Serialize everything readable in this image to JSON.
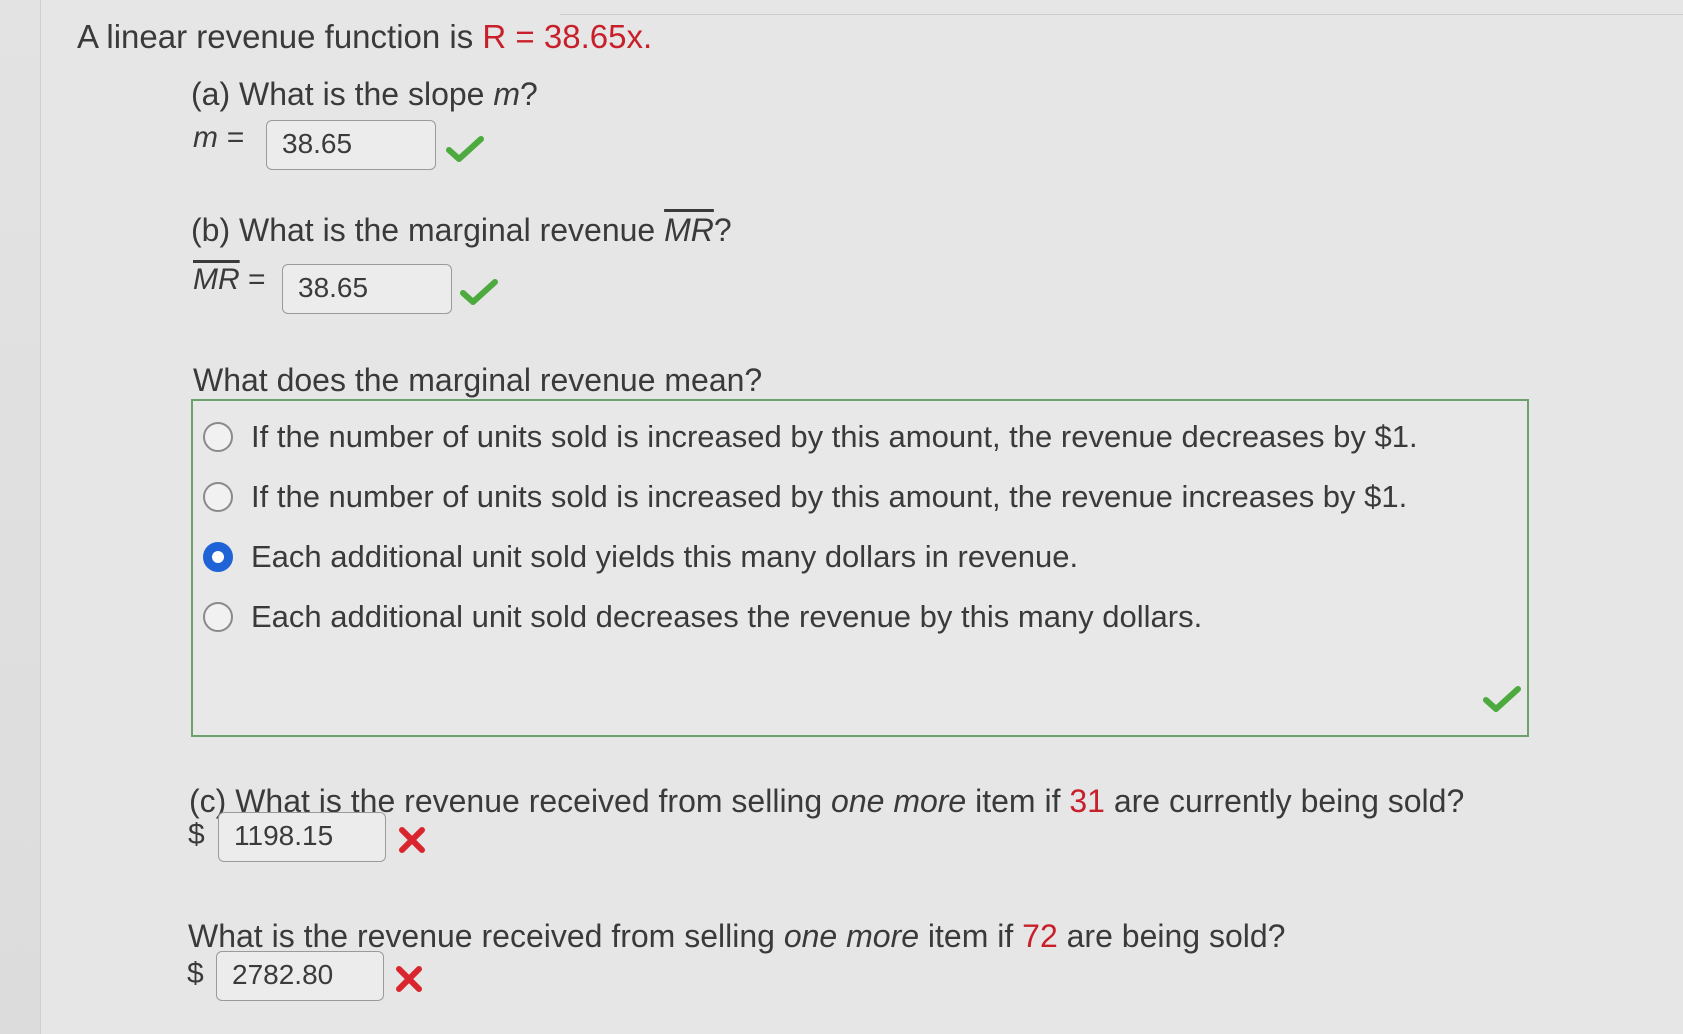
{
  "problem": {
    "intro": "A linear revenue function is",
    "equation": "R = 38.65x."
  },
  "part_a": {
    "label": "(a)",
    "question_prefix": "What is the slope",
    "question_var": "m",
    "question_suffix": "?",
    "eq_label": "m =",
    "answer": "38.65",
    "status": "correct"
  },
  "part_b": {
    "label": "(b)",
    "question_prefix": "What is the marginal revenue",
    "question_var": "MR",
    "question_suffix": "?",
    "eq_var": "MR",
    "eq_sign": "=",
    "answer": "38.65",
    "status": "correct"
  },
  "meaning": {
    "question": "What does the marginal revenue mean?",
    "options": [
      {
        "text": "If the number of units sold is increased by this amount, the revenue decreases by $1.",
        "selected": false
      },
      {
        "text": "If the number of units sold is increased by this amount, the revenue increases by $1.",
        "selected": false
      },
      {
        "text": "Each additional unit sold yields this many dollars in revenue.",
        "selected": true
      },
      {
        "text": "Each additional unit sold decreases the revenue by this many dollars.",
        "selected": false
      }
    ],
    "status": "correct"
  },
  "part_c": {
    "label": "(c)",
    "question_prefix": "What is the revenue received from selling",
    "question_emph": "one more",
    "question_mid": "item if",
    "count": "31",
    "question_suffix": "are currently being sold?",
    "currency": "$",
    "answer": "1198.15",
    "status": "incorrect"
  },
  "part_d": {
    "question_prefix": "What is the revenue received from selling",
    "question_emph": "one more",
    "question_mid": "item if",
    "count": "72",
    "question_suffix": "are being sold?",
    "currency": "$",
    "answer": "2782.80",
    "status": "incorrect"
  },
  "colors": {
    "correct": "#4caa3f",
    "incorrect": "#d9262e",
    "highlight": "#c8202a",
    "selected_radio": "#1f63d6",
    "box_border": "#6da36b"
  }
}
